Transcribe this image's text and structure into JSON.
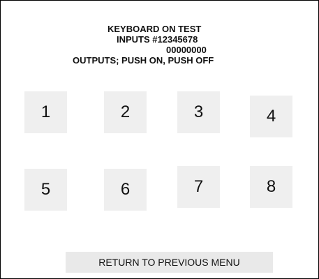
{
  "header": {
    "title": "KEYBOARD ON TEST",
    "inputs_label": "INPUTS #12345678",
    "inputs_values": "00000000",
    "outputs_label": "OUTPUTS; PUSH ON, PUSH OFF"
  },
  "keys": [
    {
      "label": "1"
    },
    {
      "label": "2"
    },
    {
      "label": "3"
    },
    {
      "label": "4"
    },
    {
      "label": "5"
    },
    {
      "label": "6"
    },
    {
      "label": "7"
    },
    {
      "label": "8"
    }
  ],
  "footer": {
    "return_label": "RETURN TO PREVIOUS MENU"
  },
  "colors": {
    "background": "#ffffff",
    "key_fill": "#efefef",
    "button_fill": "#e9e9e9",
    "border": "#000000"
  }
}
